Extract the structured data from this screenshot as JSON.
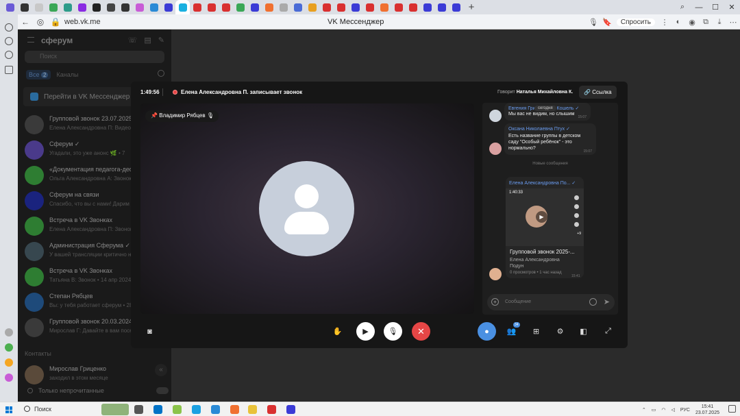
{
  "browser": {
    "url": "web.vk.me",
    "page_title": "VK Мессенджер",
    "ask_label": "Спросить",
    "tab_colors": [
      "#6b5bd6",
      "#333333",
      "#c8c8c8",
      "#3aa757",
      "#2d9c8a",
      "#8a2be2",
      "#222222",
      "#444444",
      "#333333",
      "#c85cd6",
      "#2a8ad6",
      "#3b3bd6",
      "#1ab0e0",
      "#d93030",
      "#d93030",
      "#d93030",
      "#3aa757",
      "#3b3bd6",
      "#f07030",
      "#aaaaaa",
      "#4a6bd6",
      "#e8a020",
      "#d93030",
      "#d93030",
      "#3b3bd6",
      "#d93030",
      "#f07030",
      "#d93030",
      "#d93030",
      "#3b3bd6",
      "#3b3bd6",
      "#3b3bd6"
    ]
  },
  "sidebar": {
    "app_name": "сферум",
    "search_placeholder": "Поиск",
    "filter_all": "Все",
    "filter_all_count": "2",
    "filter_channels": "Каналы",
    "open_vk": "Перейти в VK Мессенджер",
    "chats": [
      {
        "name": "Групповой звонок 23.07.2025",
        "preview": "Елена Александровна П: Видео",
        "color": "#3a3a3a"
      },
      {
        "name": "Сферум ✓",
        "preview": "Угадали, это уже анонс 🌿 • 7",
        "color": "#4a3a8a"
      },
      {
        "name": "«Документация педагога-деф",
        "preview": "Ольга Александровна А: Звонок",
        "color": "#2e7d32"
      },
      {
        "name": "Сферум на связи",
        "preview": "Спасибо, что вы с нами! Дарим",
        "color": "#1a237e"
      },
      {
        "name": "Встреча в VK Звонках",
        "preview": "Елена Александровна П: Звонок",
        "color": "#2e7d32"
      },
      {
        "name": "Администрация Сферума ✓",
        "preview": "У вашей трансляции критично н",
        "color": "#37474f"
      },
      {
        "name": "Встреча в VK Звонках",
        "preview": "Татьяна В: Звонок • 14 апр 2024",
        "color": "#2e7d32"
      },
      {
        "name": "Степан Рябцев",
        "preview": "Вы: у тебя работает сферум • 28",
        "color": "#1e4a7a"
      },
      {
        "name": "Групповой звонок 20.03.2024",
        "preview": "Мирослав Г: Давайте в вам посе",
        "color": "#3a3a3a"
      }
    ],
    "section_contacts": "Контакты",
    "contact": {
      "name": "Мирослав Гриценко",
      "preview": "заходил в этом месяце"
    },
    "only_unread": "Только непрочитанные"
  },
  "call": {
    "timer": "1:49:56",
    "recording": "Елена Александровна П. записывает звонок",
    "speaking_label": "Говорит",
    "speaking_name": "Наталья Михайловна К.",
    "link_label": "Ссылка",
    "participant": "Владимир Рябцев",
    "participants_count": "34"
  },
  "chat": {
    "today": "сегодня",
    "new_messages": "Новые сообщения",
    "messages": [
      {
        "author": "Евгения Григорьевна Кошель ✓",
        "text": "Мы вас не видим, но слышим",
        "time": "15:07"
      },
      {
        "author": "Оксана Николаевна Птух ✓",
        "text": "Есть название группы в детском саду \"Особый ребёнок\" - это нормально?",
        "time": "15:07"
      }
    ],
    "video": {
      "author": "Елена Александровна По... ✓",
      "duration": "1:40:33",
      "title": "Групповой звонок 2025-...",
      "owner": "Елена Александровна Подун",
      "stats": "0 просмотров • 1 час назад",
      "time": "15:41"
    },
    "input_placeholder": "Сообщение"
  },
  "taskbar": {
    "search": "Поиск",
    "lang": "РУС",
    "time": "15:41",
    "date": "23.07.2025"
  }
}
